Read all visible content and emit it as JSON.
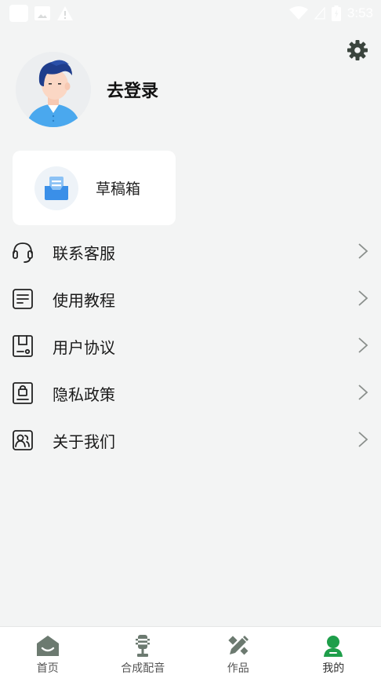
{
  "status_bar": {
    "time": "3:53",
    "icons": [
      "app-square-icon",
      "image-icon",
      "warning-icon",
      "wifi-icon",
      "signal-icon",
      "battery-icon"
    ]
  },
  "header": {
    "settings_icon": "gear-icon",
    "login_label": "去登录",
    "avatar": "user-avatar"
  },
  "draft_box": {
    "label": "草稿箱",
    "icon": "inbox-icon"
  },
  "menu": {
    "items": [
      {
        "label": "联系客服",
        "icon": "headset-icon"
      },
      {
        "label": "使用教程",
        "icon": "document-icon"
      },
      {
        "label": "用户协议",
        "icon": "agreement-icon"
      },
      {
        "label": "隐私政策",
        "icon": "privacy-lock-icon"
      },
      {
        "label": "关于我们",
        "icon": "contacts-icon"
      }
    ]
  },
  "bottom_nav": {
    "items": [
      {
        "label": "首页",
        "icon": "home-icon",
        "active": false
      },
      {
        "label": "合成配音",
        "icon": "microphone-icon",
        "active": false
      },
      {
        "label": "作品",
        "icon": "pencil-ruler-icon",
        "active": false
      },
      {
        "label": "我的",
        "icon": "profile-icon",
        "active": true
      }
    ]
  },
  "colors": {
    "background": "#f3f4f4",
    "accent_green": "#1e9e4a",
    "nav_icon_gray": "#6c7a70",
    "text_primary": "#1a1a1a"
  }
}
